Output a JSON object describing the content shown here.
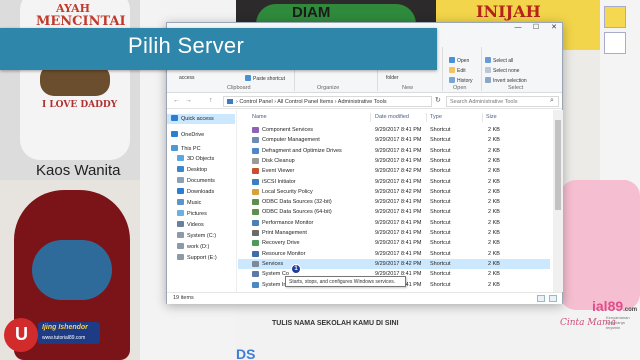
{
  "banner": {
    "title": "Pilih Server"
  },
  "background": {
    "shirt_top_line": "AYAH",
    "shirt_mid_line": "MENCINTAI",
    "shirt_bottom_line": "I LOVE DADDY",
    "caption_left": "Kaos Wanita",
    "shirt_dark_text": "DIAM",
    "shirt_yellow_text": "INIJAH",
    "shirt_bottom_text": "TULIS NAMA SEKOLAH KAMU DI SINI",
    "kids_text": "KIDS",
    "pink_caption": "Cinta Mama",
    "watermark_prefix": "ial89",
    "watermark_suffix": ".com",
    "watermark_sub": "Kenyamanan berbelanja terjamin",
    "corner_badge_line1": "Ijing Ishendor",
    "corner_badge_line2": "www.tutorial89.com"
  },
  "window": {
    "controls": {
      "minimize": "—",
      "maximize": "☐",
      "close": "✕"
    },
    "ribbon": {
      "access": "access",
      "paste_shortcut": "Paste shortcut",
      "folder": "folder",
      "open": "Open",
      "edit": "Edit",
      "history": "History",
      "select_all": "Select all",
      "select_none": "Select none",
      "invert_selection": "Invert selection",
      "groups": [
        "Clipboard",
        "Organize",
        "New",
        "Open",
        "Select"
      ]
    },
    "nav": {
      "back": "←",
      "forward": "→",
      "up": "↑",
      "address": "› Control Panel › All Control Panel Items › Administrative Tools",
      "refresh": "↻",
      "search_placeholder": "Search Administrative Tools",
      "search_icon": "⌕"
    },
    "sidebar": [
      {
        "label": "Quick access",
        "icon": "star-icon",
        "color": "#2a7fd4"
      },
      {
        "label": "OneDrive",
        "icon": "cloud-icon",
        "color": "#2a7fd4"
      },
      {
        "label": "This PC",
        "icon": "pc-icon",
        "color": "#4a9ad8"
      },
      {
        "label": "3D Objects",
        "icon": "cube-icon",
        "color": "#58a8e6"
      },
      {
        "label": "Desktop",
        "icon": "desktop-icon",
        "color": "#3a86cf"
      },
      {
        "label": "Documents",
        "icon": "documents-icon",
        "color": "#8aa0b8"
      },
      {
        "label": "Downloads",
        "icon": "downloads-icon",
        "color": "#2a7fd4"
      },
      {
        "label": "Music",
        "icon": "music-icon",
        "color": "#5e95c9"
      },
      {
        "label": "Pictures",
        "icon": "pictures-icon",
        "color": "#6ab0e0"
      },
      {
        "label": "Videos",
        "icon": "videos-icon",
        "color": "#6c7f9a"
      },
      {
        "label": "System (C:)",
        "icon": "drive-icon",
        "color": "#8c9aa8"
      },
      {
        "label": "work (D:)",
        "icon": "drive-icon",
        "color": "#8c9aa8"
      },
      {
        "label": "Support (E:)",
        "icon": "drive-icon",
        "color": "#8c9aa8"
      }
    ],
    "columns": {
      "name": "Name",
      "date": "Date modified",
      "type": "Type",
      "size": "Size"
    },
    "files": [
      {
        "name": "Component Services",
        "date": "9/29/2017 8:41 PM",
        "type": "Shortcut",
        "size": "2 KB",
        "color": "#8c63b8"
      },
      {
        "name": "Computer Management",
        "date": "9/29/2017 8:41 PM",
        "type": "Shortcut",
        "size": "2 KB",
        "color": "#6c8cb0"
      },
      {
        "name": "Defragment and Optimize Drives",
        "date": "9/29/2017 8:41 PM",
        "type": "Shortcut",
        "size": "2 KB",
        "color": "#4c88c8"
      },
      {
        "name": "Disk Cleanup",
        "date": "9/29/2017 8:41 PM",
        "type": "Shortcut",
        "size": "2 KB",
        "color": "#9a9a9a"
      },
      {
        "name": "Event Viewer",
        "date": "9/29/2017 8:42 PM",
        "type": "Shortcut",
        "size": "2 KB",
        "color": "#c8502e"
      },
      {
        "name": "iSCSI Initiator",
        "date": "9/29/2017 8:41 PM",
        "type": "Shortcut",
        "size": "2 KB",
        "color": "#3a7fc0"
      },
      {
        "name": "Local Security Policy",
        "date": "9/29/2017 8:42 PM",
        "type": "Shortcut",
        "size": "2 KB",
        "color": "#d8a13a"
      },
      {
        "name": "ODBC Data Sources (32-bit)",
        "date": "9/29/2017 8:41 PM",
        "type": "Shortcut",
        "size": "2 KB",
        "color": "#5d8f4e"
      },
      {
        "name": "ODBC Data Sources (64-bit)",
        "date": "9/29/2017 8:41 PM",
        "type": "Shortcut",
        "size": "2 KB",
        "color": "#5d8f4e"
      },
      {
        "name": "Performance Monitor",
        "date": "9/29/2017 8:41 PM",
        "type": "Shortcut",
        "size": "2 KB",
        "color": "#4a7fb8"
      },
      {
        "name": "Print Management",
        "date": "9/29/2017 8:41 PM",
        "type": "Shortcut",
        "size": "2 KB",
        "color": "#6a6a6a"
      },
      {
        "name": "Recovery Drive",
        "date": "9/29/2017 8:41 PM",
        "type": "Shortcut",
        "size": "2 KB",
        "color": "#4a9a5a"
      },
      {
        "name": "Resource Monitor",
        "date": "9/29/2017 8:41 PM",
        "type": "Shortcut",
        "size": "2 KB",
        "color": "#3a6fa8"
      },
      {
        "name": "Services",
        "date": "9/29/2017 8:42 PM",
        "type": "Shortcut",
        "size": "2 KB",
        "color": "#7a8a9a"
      },
      {
        "name": "System Co",
        "date": "9/29/2017 8:41 PM",
        "type": "Shortcut",
        "size": "2 KB",
        "color": "#5a7aa8"
      },
      {
        "name": "System Information",
        "date": "9/29/2017 8:41 PM",
        "type": "Shortcut",
        "size": "2 KB",
        "color": "#4a8ac0"
      }
    ],
    "status_items": "19 items",
    "tooltip": "Starts, stops, and configures Windows services.",
    "marker": "1"
  }
}
